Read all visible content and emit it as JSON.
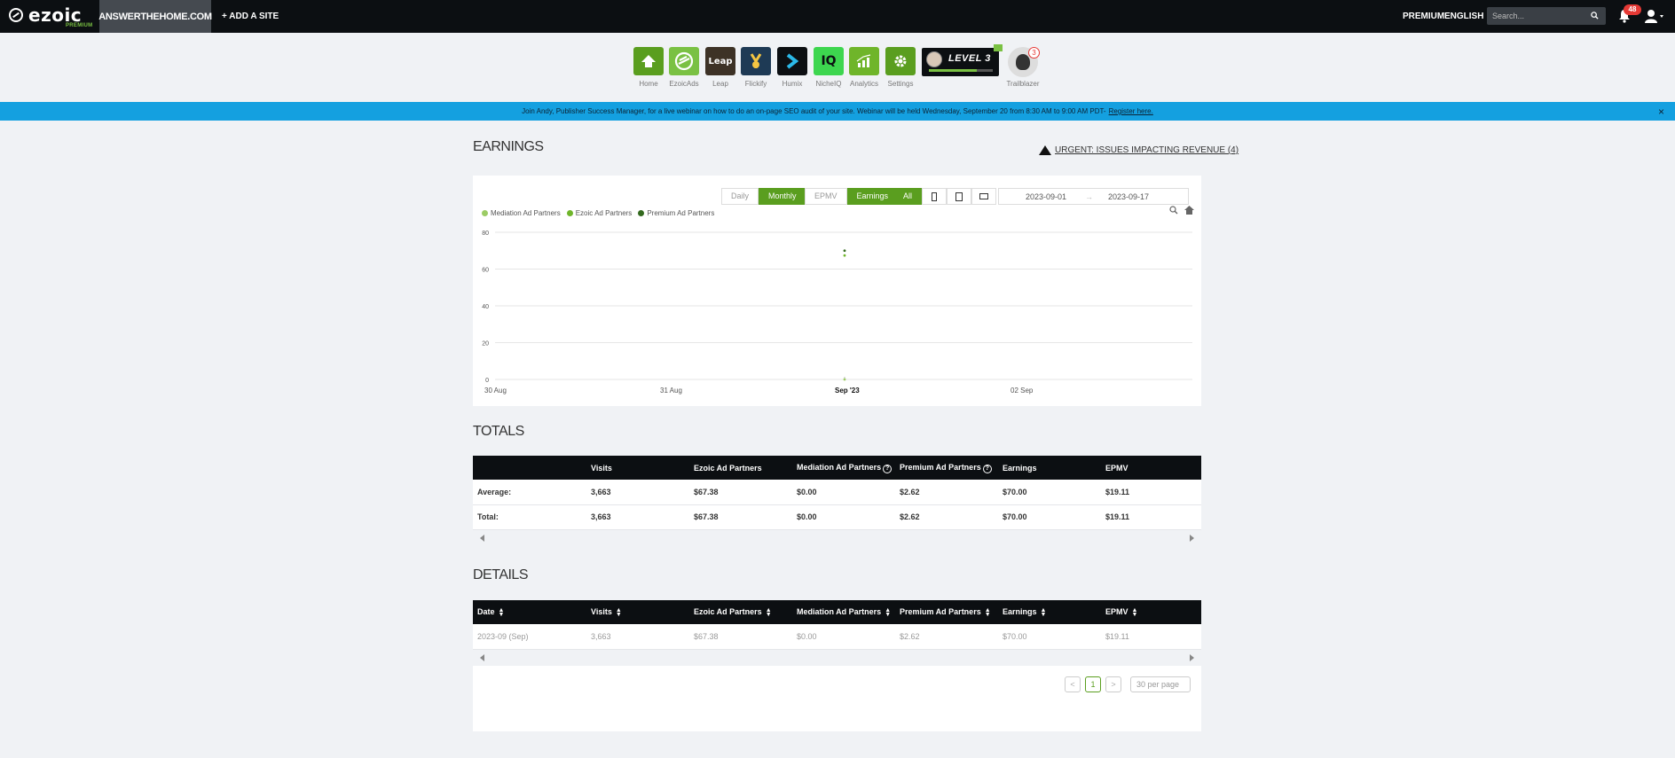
{
  "topbar": {
    "logo_text": "ezoic",
    "logo_sub": "PREMIUM",
    "site_name": "ANSWERTHEHOME.COM",
    "add_site": "+ ADD A SITE",
    "premium": "PREMIUM",
    "language": "ENGLISH",
    "search_placeholder": "Search...",
    "notification_count": "48"
  },
  "apps": [
    {
      "label": "Home",
      "color": "#5a9e1f"
    },
    {
      "label": "EzoicAds",
      "color": "#7ac143"
    },
    {
      "label": "Leap",
      "color": "#3d3226"
    },
    {
      "label": "Flickify",
      "color": "#1e3a55"
    },
    {
      "label": "Humix",
      "color": "#0c0f12"
    },
    {
      "label": "NicheIQ",
      "color": "#3dd64f"
    },
    {
      "label": "Analytics",
      "color": "#6fb52a"
    },
    {
      "label": "Settings",
      "color": "#5a9e1f"
    }
  ],
  "level": {
    "text": "LEVEL 3",
    "progress": 0.75
  },
  "trailblazer": {
    "label": "Trailblazer",
    "count": "3"
  },
  "banner": {
    "text": "Join Andy, Publisher Success Manager, for a live webinar on how to do an on-page SEO audit of your site. Webinar will be held Wednesday, September 20 from 8:30 AM to 9:00 AM PDT-",
    "link": "Register here.",
    "close": "×"
  },
  "earnings": {
    "title": "EARNINGS",
    "urgent": "URGENT: ISSUES IMPACTING REVENUE (4)",
    "toggles": {
      "daily": "Daily",
      "monthly": "Monthly",
      "epmv": "EPMV",
      "earnings_btn": "Earnings",
      "all": "All"
    },
    "date_start": "2023-09-01",
    "date_sep": "→",
    "date_end": "2023-09-17",
    "legend": [
      {
        "name": "Mediation Ad Partners",
        "color": "#9ccc65"
      },
      {
        "name": "Ezoic Ad Partners",
        "color": "#6fb52a"
      },
      {
        "name": "Premium Ad Partners",
        "color": "#33691e"
      }
    ]
  },
  "chart_data": {
    "type": "scatter",
    "title": "",
    "xlabel": "",
    "ylabel": "",
    "x_ticks": [
      "30 Aug",
      "31 Aug",
      "Sep '23",
      "02 Sep"
    ],
    "y_ticks": [
      "0",
      "20",
      "40",
      "60",
      "80"
    ],
    "ylim": [
      0,
      80
    ],
    "grid": true,
    "legend_position": "top-left",
    "series": [
      {
        "name": "Mediation Ad Partners",
        "color": "#9ccc65",
        "points": [
          {
            "x": "Sep '23",
            "y": 0
          }
        ]
      },
      {
        "name": "Ezoic Ad Partners",
        "color": "#6fb52a",
        "points": [
          {
            "x": "Sep '23",
            "y": 67.38
          }
        ]
      },
      {
        "name": "Premium Ad Partners",
        "color": "#33691e",
        "points": [
          {
            "x": "Sep '23",
            "y": 70.0
          }
        ]
      }
    ]
  },
  "totals": {
    "title": "TOTALS",
    "headers": [
      "",
      "Visits",
      "Ezoic Ad Partners",
      "Mediation Ad Partners",
      "Premium Ad Partners",
      "Earnings",
      "EPMV"
    ],
    "rows": [
      [
        "Average:",
        "3,663",
        "$67.38",
        "$0.00",
        "$2.62",
        "$70.00",
        "$19.11"
      ],
      [
        "Total:",
        "3,663",
        "$67.38",
        "$0.00",
        "$2.62",
        "$70.00",
        "$19.11"
      ]
    ]
  },
  "details": {
    "title": "DETAILS",
    "headers": [
      "Date",
      "Visits",
      "Ezoic Ad Partners",
      "Mediation Ad Partners",
      "Premium Ad Partners",
      "Earnings",
      "EPMV"
    ],
    "rows": [
      [
        "2023-09 (Sep)",
        "3,663",
        "$67.38",
        "$0.00",
        "$2.62",
        "$70.00",
        "$19.11"
      ]
    ],
    "pager": {
      "prev": "<",
      "page": "1",
      "next": ">",
      "per_page": "30 per page"
    }
  }
}
